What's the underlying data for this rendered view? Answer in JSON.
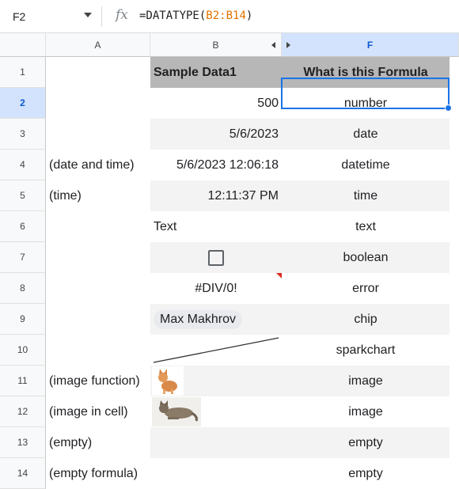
{
  "formula_bar": {
    "name_box": "F2",
    "fx_label": "fx",
    "formula_prefix": "=DATATYPE(",
    "formula_ref": "B2:B14",
    "formula_suffix": ")"
  },
  "columns": [
    {
      "label": "A"
    },
    {
      "label": "B"
    },
    {
      "label": "F"
    }
  ],
  "rows": [
    {
      "num": "1",
      "a": "",
      "b": "Sample Data1",
      "f": "What is this Formula"
    },
    {
      "num": "2",
      "a": "",
      "b": "500",
      "f": "number"
    },
    {
      "num": "3",
      "a": "",
      "b": "5/6/2023",
      "f": "date"
    },
    {
      "num": "4",
      "a": "(date and time)",
      "b": "5/6/2023 12:06:18",
      "f": "datetime"
    },
    {
      "num": "5",
      "a": "(time)",
      "b": "12:11:37 PM",
      "f": "time"
    },
    {
      "num": "6",
      "a": "",
      "b": "Text",
      "f": "text"
    },
    {
      "num": "7",
      "a": "",
      "b": "",
      "f": "boolean"
    },
    {
      "num": "8",
      "a": "",
      "b": "#DIV/0!",
      "f": "error"
    },
    {
      "num": "9",
      "a": "",
      "b": "Max Makhrov",
      "f": "chip"
    },
    {
      "num": "10",
      "a": "",
      "b": "",
      "f": "sparkchart"
    },
    {
      "num": "11",
      "a": "(image function)",
      "b": "",
      "f": "image"
    },
    {
      "num": "12",
      "a": "(image in cell)",
      "b": "",
      "f": "image"
    },
    {
      "num": "13",
      "a": "(empty)",
      "b": "",
      "f": "empty"
    },
    {
      "num": "14",
      "a": "(empty formula)",
      "b": "",
      "f": "empty"
    }
  ],
  "colors": {
    "selection": "#1a73e8",
    "header_fill": "#b7b7b7",
    "band_fill": "#f3f3f3",
    "formula_ref": "#e37400",
    "error_marker": "#d93025"
  }
}
